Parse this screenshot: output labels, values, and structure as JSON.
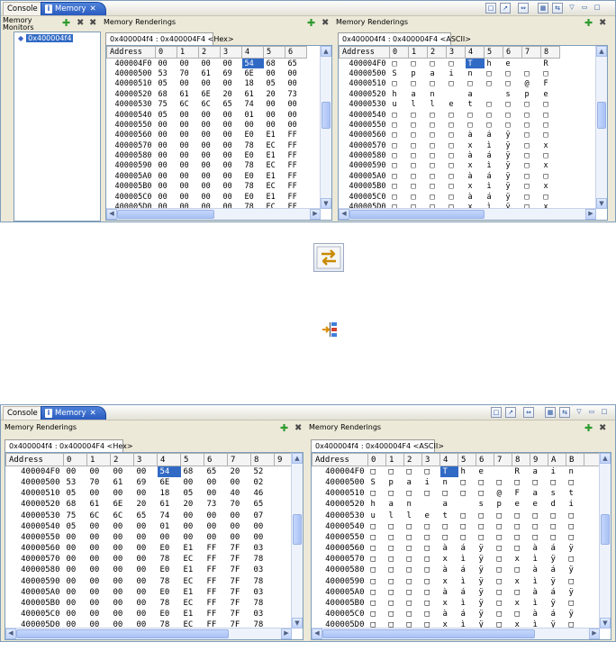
{
  "tabs": {
    "console": "Console",
    "memory": "Memory",
    "close": "✕"
  },
  "pane": {
    "monitors_title": "Memory Monitors",
    "renderings_title": "Memory Renderings",
    "monitor_address": "0x400004f4",
    "hex_tab": "0x400004f4 : 0x400004F4 <Hex>",
    "ascii_tab": "0x400004f4 : 0x400004F4 <ASCII>"
  },
  "columns": [
    "Address",
    "0",
    "1",
    "2",
    "3",
    "4",
    "5",
    "6",
    "7",
    "8",
    "9",
    "A",
    "B"
  ],
  "top_hex_cols": 7,
  "top_ascii_cols": 9,
  "bottom_hex_cols": 10,
  "bottom_ascii_cols": 13,
  "selected_column": 4,
  "rows": [
    {
      "a": "400004F0",
      "h": [
        "00",
        "00",
        "00",
        "00",
        "54",
        "68",
        "65",
        "20",
        "52"
      ],
      "c": [
        "□",
        "□",
        "□",
        "□",
        "T",
        "h",
        "e",
        " ",
        "R",
        "a",
        "i",
        "n"
      ]
    },
    {
      "a": "40000500",
      "h": [
        "53",
        "70",
        "61",
        "69",
        "6E",
        "00",
        "00",
        "00",
        "02"
      ],
      "c": [
        "S",
        "p",
        "a",
        "i",
        "n",
        "□",
        "□",
        "□",
        "□",
        "□",
        "□",
        "□"
      ]
    },
    {
      "a": "40000510",
      "h": [
        "05",
        "00",
        "00",
        "00",
        "18",
        "05",
        "00",
        "40",
        "46"
      ],
      "c": [
        "□",
        "□",
        "□",
        "□",
        "□",
        "□",
        "□",
        "@",
        "F",
        "a",
        "s",
        "t"
      ]
    },
    {
      "a": "40000520",
      "h": [
        "68",
        "61",
        "6E",
        "20",
        "61",
        "20",
        "73",
        "70",
        "65"
      ],
      "c": [
        "h",
        "a",
        "n",
        " ",
        "a",
        " ",
        "s",
        "p",
        "e",
        "e",
        "d",
        "i"
      ]
    },
    {
      "a": "40000530",
      "h": [
        "75",
        "6C",
        "6C",
        "65",
        "74",
        "00",
        "00",
        "00",
        "07"
      ],
      "c": [
        "u",
        "l",
        "l",
        "e",
        "t",
        "□",
        "□",
        "□",
        "□",
        "□",
        "□",
        "□"
      ]
    },
    {
      "a": "40000540",
      "h": [
        "05",
        "00",
        "00",
        "00",
        "01",
        "00",
        "00",
        "00",
        "00"
      ],
      "c": [
        "□",
        "□",
        "□",
        "□",
        "□",
        "□",
        "□",
        "□",
        "□",
        "□",
        "□",
        "□"
      ]
    },
    {
      "a": "40000550",
      "h": [
        "00",
        "00",
        "00",
        "00",
        "00",
        "00",
        "00",
        "00",
        "00"
      ],
      "c": [
        "□",
        "□",
        "□",
        "□",
        "□",
        "□",
        "□",
        "□",
        "□",
        "□",
        "□",
        "□"
      ]
    },
    {
      "a": "40000560",
      "h": [
        "00",
        "00",
        "00",
        "00",
        "E0",
        "E1",
        "FF",
        "7F",
        "03"
      ],
      "c": [
        "□",
        "□",
        "□",
        "□",
        "à",
        "á",
        "ÿ",
        "□",
        "□",
        "à",
        "á",
        "ÿ"
      ]
    },
    {
      "a": "40000570",
      "h": [
        "00",
        "00",
        "00",
        "00",
        "78",
        "EC",
        "FF",
        "7F",
        "78"
      ],
      "c": [
        "□",
        "□",
        "□",
        "□",
        "x",
        "ì",
        "ÿ",
        "□",
        "x",
        "ì",
        "ÿ",
        "□"
      ]
    },
    {
      "a": "40000580",
      "h": [
        "00",
        "00",
        "00",
        "00",
        "E0",
        "E1",
        "FF",
        "7F",
        "03"
      ],
      "c": [
        "□",
        "□",
        "□",
        "□",
        "à",
        "á",
        "ÿ",
        "□",
        "□",
        "à",
        "á",
        "ÿ"
      ]
    },
    {
      "a": "40000590",
      "h": [
        "00",
        "00",
        "00",
        "00",
        "78",
        "EC",
        "FF",
        "7F",
        "78"
      ],
      "c": [
        "□",
        "□",
        "□",
        "□",
        "x",
        "ì",
        "ÿ",
        "□",
        "x",
        "ì",
        "ÿ",
        "□"
      ]
    },
    {
      "a": "400005A0",
      "h": [
        "00",
        "00",
        "00",
        "00",
        "E0",
        "E1",
        "FF",
        "7F",
        "03"
      ],
      "c": [
        "□",
        "□",
        "□",
        "□",
        "à",
        "á",
        "ÿ",
        "□",
        "□",
        "à",
        "á",
        "ÿ"
      ]
    },
    {
      "a": "400005B0",
      "h": [
        "00",
        "00",
        "00",
        "00",
        "78",
        "EC",
        "FF",
        "7F",
        "78"
      ],
      "c": [
        "□",
        "□",
        "□",
        "□",
        "x",
        "ì",
        "ÿ",
        "□",
        "x",
        "ì",
        "ÿ",
        "□"
      ]
    },
    {
      "a": "400005C0",
      "h": [
        "00",
        "00",
        "00",
        "00",
        "E0",
        "E1",
        "FF",
        "7F",
        "03"
      ],
      "c": [
        "□",
        "□",
        "□",
        "□",
        "à",
        "á",
        "ÿ",
        "□",
        "□",
        "à",
        "á",
        "ÿ"
      ]
    },
    {
      "a": "400005D0",
      "h": [
        "00",
        "00",
        "00",
        "00",
        "78",
        "EC",
        "FF",
        "7F",
        "78"
      ],
      "c": [
        "□",
        "□",
        "□",
        "□",
        "x",
        "ì",
        "ÿ",
        "□",
        "x",
        "ì",
        "ÿ",
        "□"
      ]
    }
  ],
  "icons": {
    "toggle_monitors": "toggle-split-pane-icon",
    "link_renderings": "link-rendering-panes-icon"
  },
  "colors": {
    "selection": "#316ac5",
    "tab_active": "#2a5bc0",
    "add": "#2e9b2e"
  }
}
